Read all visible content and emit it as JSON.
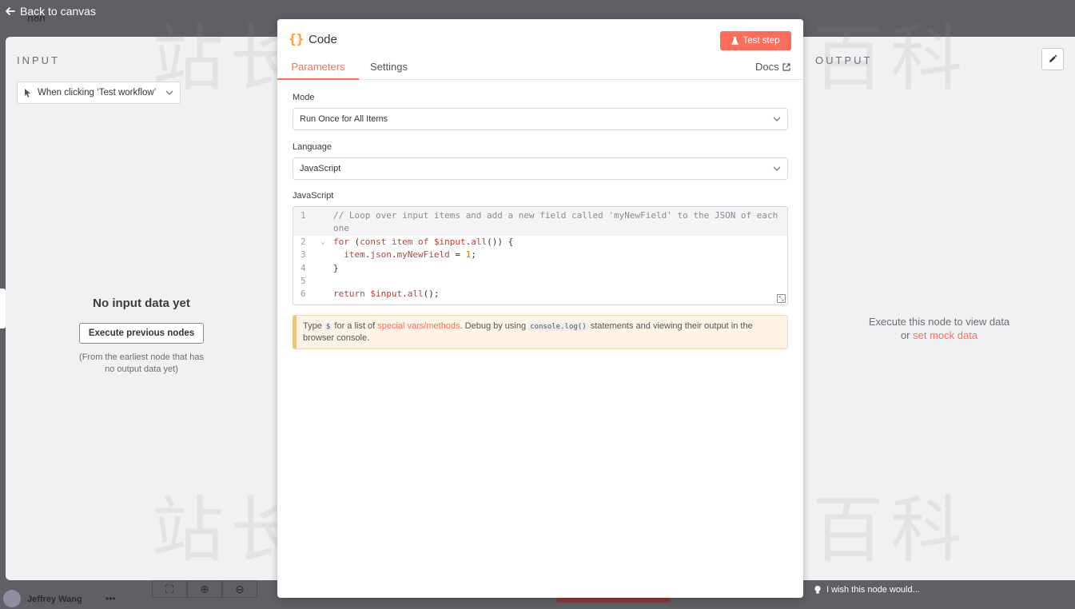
{
  "topbar": {
    "back_label": "Back to canvas",
    "logo_text": "n8n"
  },
  "input_panel": {
    "title": "INPUT",
    "trigger_select": "When clicking ‘Test workflow’",
    "empty_title": "No input data yet",
    "execute_button": "Execute previous nodes",
    "empty_note_line1": "(From the earliest node that has",
    "empty_note_line2": "no output data yet)"
  },
  "output_panel": {
    "title": "OUTPUT",
    "message_line1": "Execute this node to view data",
    "message_or": "or",
    "mock_link": "set mock data"
  },
  "node": {
    "icon_text": "{}",
    "title": "Code",
    "test_button": "Test step",
    "tabs": [
      "Parameters",
      "Settings"
    ],
    "docs_label": "Docs"
  },
  "parameters": {
    "mode_label": "Mode",
    "mode_value": "Run Once for All Items",
    "language_label": "Language",
    "language_value": "JavaScript",
    "code_label": "JavaScript",
    "line_numbers": [
      "1",
      "2",
      "3",
      "4",
      "5",
      "6"
    ]
  },
  "hint": {
    "prefix": "Type",
    "symbol": "$",
    "mid": "for a list of",
    "link": "special vars/methods",
    "after_link": ". Debug by using",
    "code": "console.log()",
    "suffix": "statements and viewing their output in the browser console."
  },
  "bottombar": {
    "user_name": "Jeffrey Wang",
    "dots": "•••",
    "feedback": "I wish this node would..."
  },
  "watermark": "站长百科",
  "colors": {
    "accent": "#ff6d5a",
    "icon_orange": "#ff9b26",
    "backdrop": "#5f5f66"
  }
}
